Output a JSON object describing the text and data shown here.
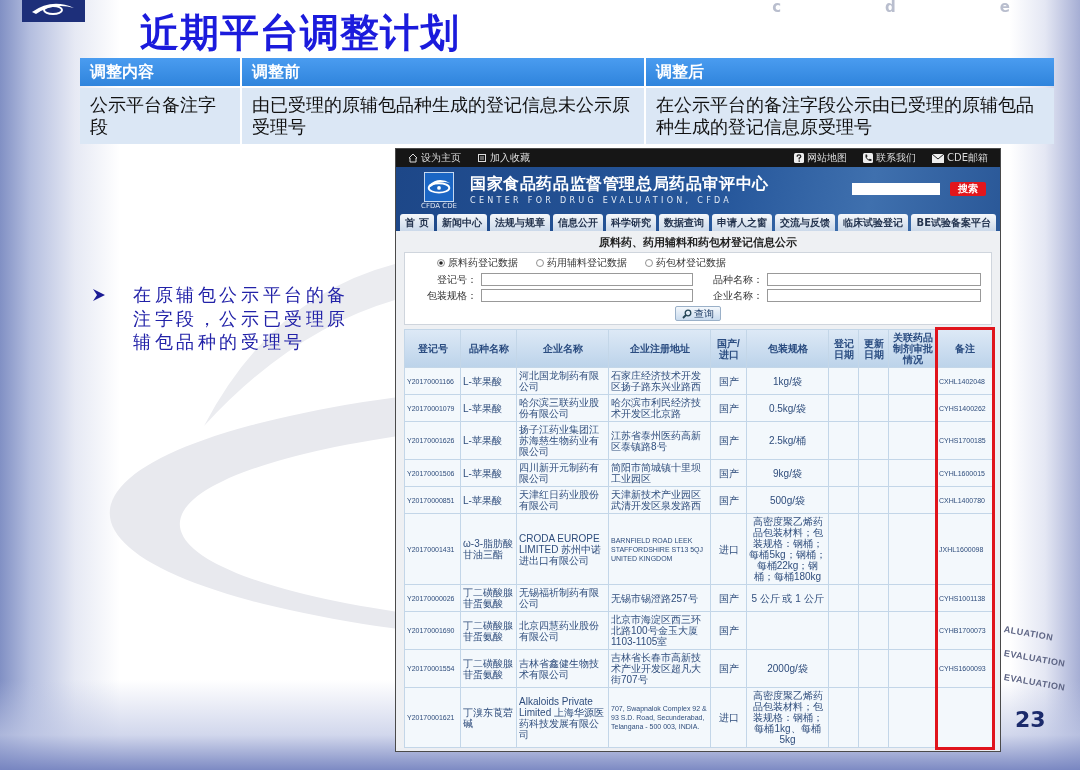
{
  "slide": {
    "title": "近期平台调整计划",
    "corner_letters": [
      "c",
      "d",
      "e"
    ],
    "edge_marks": [
      "ALUATION",
      "EVALUATION",
      "EVALUATION"
    ],
    "page_number": "23"
  },
  "plan_table": {
    "columns": [
      "调整内容",
      "调整前",
      "调整后"
    ],
    "rows": [
      [
        "公示平台备注字段",
        "由已受理的原辅包品种生成的登记信息未公示原受理号",
        "在公示平台的备注字段公示由已受理的原辅包品种生成的登记信息原受理号"
      ]
    ]
  },
  "bullets": [
    "在原辅包公示平台的备注字段，公示已受理原辅包品种的受理号"
  ],
  "website_screenshot": {
    "left_links": [
      {
        "kind": "home",
        "label": "设为主页"
      },
      {
        "kind": "bookmark",
        "label": "加入收藏"
      }
    ],
    "right_links": [
      {
        "kind": "sitemap",
        "label": "网站地图"
      },
      {
        "kind": "contact",
        "label": "联系我们"
      },
      {
        "kind": "mail",
        "label": "CDE邮箱"
      }
    ],
    "logo_caption": "CFDA CDE",
    "site_title": "国家食品药品监督管理总局药品审评中心",
    "site_subtitle": "CENTER FOR DRUG EVALUATION, CFDA",
    "search_button": "搜索",
    "nav_tabs": [
      "首 页",
      "新闻中心",
      "法规与规章",
      "信息公开",
      "科学研究",
      "数据查询",
      "申请人之窗",
      "交流与反馈",
      "临床试验登记",
      "BE试验备案平台"
    ],
    "page_title": "原料药、药用辅料和药包材登记信息公示",
    "data_types": [
      {
        "label": "原料药登记数据",
        "selected": true
      },
      {
        "label": "药用辅料登记数据",
        "selected": false
      },
      {
        "label": "药包材登记数据",
        "selected": false
      }
    ],
    "fields": [
      {
        "label": "登记号："
      },
      {
        "label": "品种名称："
      },
      {
        "label": "包装规格："
      },
      {
        "label": "企业名称："
      }
    ],
    "query_button": "查询",
    "table": {
      "columns": [
        {
          "label": "登记号",
          "highlighted": false
        },
        {
          "label": "品种名称",
          "highlighted": false
        },
        {
          "label": "企业名称",
          "highlighted": false
        },
        {
          "label": "企业注册地址",
          "highlighted": false
        },
        {
          "label": "国产/进口",
          "highlighted": false
        },
        {
          "label": "包装规格",
          "highlighted": false
        },
        {
          "label": "登记日期",
          "highlighted": false
        },
        {
          "label": "更新日期",
          "highlighted": false
        },
        {
          "label": "关联药品制剂审批情况",
          "highlighted": false
        },
        {
          "label": "备注",
          "highlighted": true
        }
      ],
      "rows": [
        {
          "registration_no": "Y20170001166",
          "variety_name": "L-苹果酸",
          "company_name": "河北国龙制药有限公司",
          "company_address": "石家庄经济技术开发区扬子路东兴业路西",
          "origin": "国产",
          "package_spec": "1kg/袋",
          "remark": "CXHL1402048"
        },
        {
          "registration_no": "Y20170001079",
          "variety_name": "L-苹果酸",
          "company_name": "哈尔滨三联药业股份有限公司",
          "company_address": "哈尔滨市利民经济技术开发区北京路",
          "origin": "国产",
          "package_spec": "0.5kg/袋",
          "remark": "CYHS1400262"
        },
        {
          "registration_no": "Y20170001626",
          "variety_name": "L-苹果酸",
          "company_name": "扬子江药业集团江苏海慈生物药业有限公司",
          "company_address": "江苏省泰州医药高新区泰镇路8号",
          "origin": "国产",
          "package_spec": "2.5kg/桶",
          "remark": "CYHS1700185"
        },
        {
          "registration_no": "Y20170001506",
          "variety_name": "L-苹果酸",
          "company_name": "四川新开元制药有限公司",
          "company_address": "简阳市简城镇十里坝工业园区",
          "origin": "国产",
          "package_spec": "9kg/袋",
          "remark": "CYHL1600015"
        },
        {
          "registration_no": "Y20170000851",
          "variety_name": "L-苹果酸",
          "company_name": "天津红日药业股份有限公司",
          "company_address": "天津新技术产业园区武清开发区泉发路西",
          "origin": "国产",
          "package_spec": "500g/袋",
          "remark": "CXHL1400780"
        },
        {
          "registration_no": "Y20170001431",
          "variety_name": "ω-3-脂肪酸甘油三酯",
          "company_name": "CRODA EUROPE LIMITED 苏州中诺进出口有限公司",
          "company_address": "BARNFIELD ROAD LEEK STAFFORDSHIRE ST13 5QJ UNITED KINGDOM",
          "origin": "进口",
          "package_spec": "高密度聚乙烯药品包装材料；包装规格：钢桶；每桶5kg；钢桶；每桶22kg；钢桶；每桶180kg",
          "remark": "JXHL1600098"
        },
        {
          "registration_no": "Y20170000026",
          "variety_name": "丁二磺酸腺苷蛋氨酸",
          "company_name": "无锡福祈制药有限公司",
          "company_address": "无锡市锡澄路257号",
          "origin": "国产",
          "package_spec": "5 公斤 或 1 公斤",
          "remark": "CYHS1001138"
        },
        {
          "registration_no": "Y20170001690",
          "variety_name": "丁二磺酸腺苷蛋氨酸",
          "company_name": "北京四慧药业股份有限公司",
          "company_address": "北京市海淀区西三环北路100号金玉大厦1103-1105室",
          "origin": "国产",
          "remark": "CYHB1700073"
        },
        {
          "registration_no": "Y20170001554",
          "variety_name": "丁二磺酸腺苷蛋氨酸",
          "company_name": "吉林省鑫健生物技术有限公司",
          "company_address": "吉林省长春市高新技术产业开发区超凡大街707号",
          "origin": "国产",
          "package_spec": "2000g/袋",
          "remark": "CYHS1600093"
        },
        {
          "registration_no": "Y20170001621",
          "variety_name": "丁溴东莨菪碱",
          "company_name": "Alkaloids Private Limited 上海华源医药科技发展有限公司",
          "company_address": "707, Swapnalok Complex 92 & 93 S.D. Road, Secunderabad, Telangana - 500 003, INDIA.",
          "origin": "进口",
          "package_spec": "高密度聚乙烯药品包装材料；包装规格：钢桶；每桶1kg、每桶5kg"
        }
      ]
    }
  }
}
